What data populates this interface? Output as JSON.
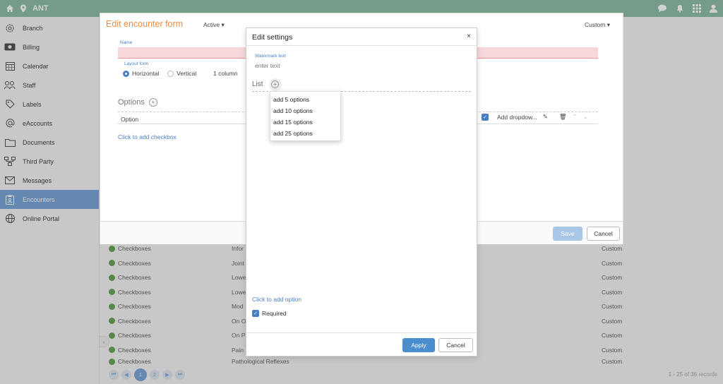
{
  "topbar": {
    "title": "ANT",
    "color": "#8fbfa6"
  },
  "sidebar": {
    "items": [
      {
        "label": "Branch",
        "icon": "gear-icon"
      },
      {
        "label": "Billing",
        "icon": "money-icon"
      },
      {
        "label": "Calendar",
        "icon": "calendar-icon"
      },
      {
        "label": "Staff",
        "icon": "staff-icon"
      },
      {
        "label": "Labels",
        "icon": "tag-icon"
      },
      {
        "label": "eAccounts",
        "icon": "at-icon"
      },
      {
        "label": "Documents",
        "icon": "folder-icon"
      },
      {
        "label": "Third Party",
        "icon": "network-icon"
      },
      {
        "label": "Messages",
        "icon": "mail-icon"
      },
      {
        "label": "Encounters",
        "icon": "clipboard-icon",
        "active": true
      },
      {
        "label": "Online Portal",
        "icon": "globe-icon"
      }
    ]
  },
  "background_list": {
    "rows": [
      {
        "type": "Checkboxes",
        "name": "Infor",
        "kind": "Custom"
      },
      {
        "type": "Checkboxes",
        "name": "Joint",
        "kind": "Custom"
      },
      {
        "type": "Checkboxes",
        "name": "Lowe",
        "kind": "Custom"
      },
      {
        "type": "Checkboxes",
        "name": "Lowe",
        "kind": "Custom"
      },
      {
        "type": "Checkboxes",
        "name": "Mod",
        "kind": "Custom"
      },
      {
        "type": "Checkboxes",
        "name": "On O",
        "kind": "Custom"
      },
      {
        "type": "Checkboxes",
        "name": "On P",
        "kind": "Custom"
      },
      {
        "type": "Checkboxes",
        "name": "Pain",
        "kind": "Custom"
      },
      {
        "type": "Checkboxes",
        "name": "Pathological Reflexes",
        "kind": "Custom"
      }
    ],
    "pages": [
      "1",
      "2"
    ],
    "records": "1 - 25 of 36 records"
  },
  "encounter_form": {
    "title": "Edit encounter form",
    "status": "Active",
    "custom": "Custom",
    "name_label": "Name",
    "layout_label": "Layout form",
    "horizontal": "Horizontal",
    "vertical": "Vertical",
    "columns": "1 column",
    "options_title": "Options",
    "option_header": "Option",
    "add_dropdown": "Add dropdow...",
    "add_checkbox": "Click to add checkbox",
    "save": "Save",
    "cancel": "Cancel"
  },
  "settings": {
    "title": "Edit settings",
    "close": "×",
    "watermark_label": "Watermark text",
    "watermark_placeholder": "enter text",
    "list_label": "List",
    "dropdown_items": [
      "add 5 options",
      "add 10 options",
      "add 15 options",
      "add 25 options"
    ],
    "add_option": "Click to add option",
    "required": "Required",
    "apply": "Apply",
    "cancel": "Cancel"
  }
}
